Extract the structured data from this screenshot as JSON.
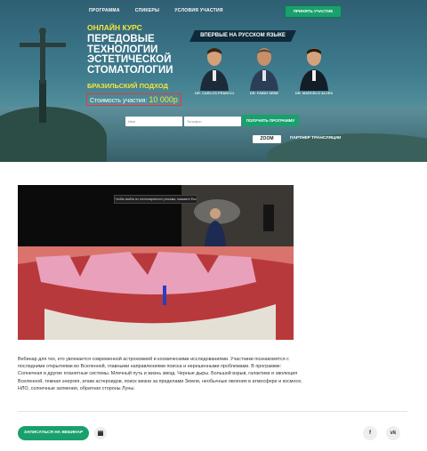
{
  "nav": {
    "items": [
      "ПРОГРАММА",
      "СПИКЕРЫ",
      "УСЛОВИЯ УЧАСТИЯ"
    ],
    "cta": "ПРИНЯТЬ УЧАСТИЕ"
  },
  "hero": {
    "kicker": "ОНЛАЙН КУРС",
    "title": "ПЕРЕДОВЫЕ ТЕХНОЛОГИИ ЭСТЕТИЧЕСКОЙ СТОМАТОЛОГИИ",
    "approach": "БРАЗИЛЬСКИЙ ПОДХОД",
    "price_label": "Стоимость участия:",
    "price_value": "10 000р",
    "ribbon": "ВПЕРВЫЕ НА РУССКОМ ЯЗЫКЕ",
    "speakers": [
      {
        "name": "DR. CARLOS FRANCCI"
      },
      {
        "name": "DR. FABIO SENE"
      },
      {
        "name": "DR. MARCELO ALVES"
      }
    ],
    "form": {
      "name_placeholder": "Имя",
      "phone_placeholder": "Телефон",
      "submit": "ПОЛУЧИТЬ ПРОГРАММУ"
    },
    "partner_logo": "ZOOM",
    "partner_text": "ПАРТНЕР ТРАНСЛЯЦИИ"
  },
  "video": {
    "tooltip": "Чтобы выйти из полноэкранного режима, нажмите Esc"
  },
  "description": "Вебинар для тех, кто увлекается современной астрономией и космическими исследованиями. Участники познакомятся с последними открытиями во Вселенной, главными направлениями поиска и нерешенными проблемами. В программе: Солнечная и другие планетные системы. Млечный путь и жизнь звезд. Черные дыры. Большой взрыв, галактики и эволюция Вселенной, темная энергия, атаки астероидов, поиск жизни за пределами Земли, необычные явления в атмосфере и космосе, НЛО, солнечные затмения, обратная стороны Луны.",
  "footer": {
    "register": "ЗАПИСАТЬСЯ НА ВЕБИНАР",
    "social": [
      "f",
      "vk"
    ]
  },
  "colors": {
    "accent": "#19a06d",
    "highlight": "#f7e53b",
    "price_border": "#e8393a"
  }
}
